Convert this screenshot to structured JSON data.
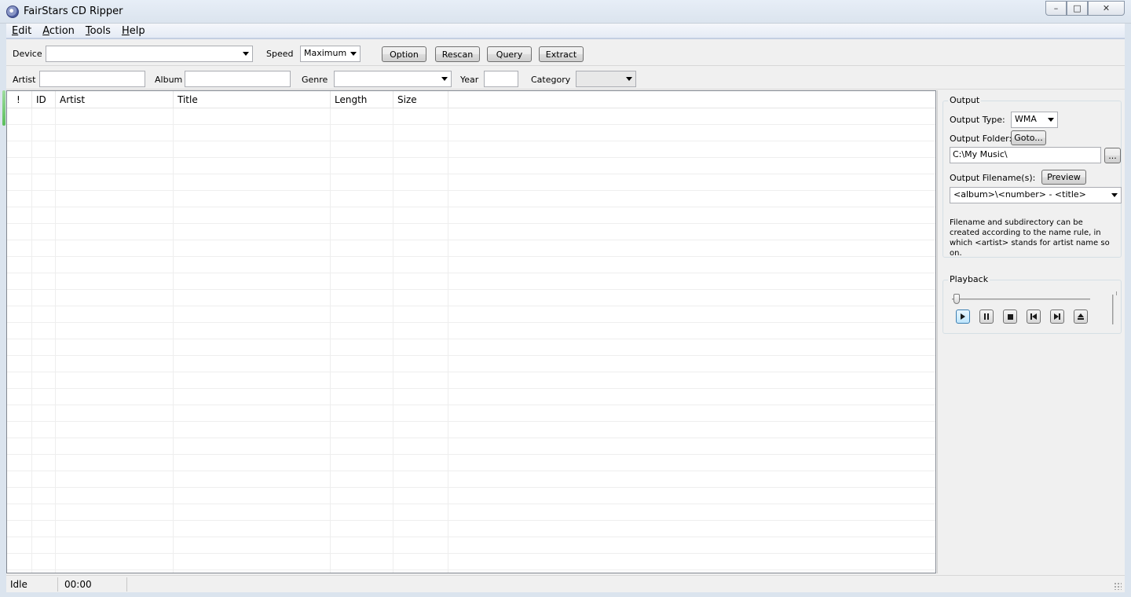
{
  "window": {
    "title": "FairStars CD Ripper",
    "min_glyph": "–",
    "max_glyph": "□",
    "close_glyph": "✕"
  },
  "menu": [
    {
      "label": "Edit",
      "accel": "E",
      "rest": "dit"
    },
    {
      "label": "Action",
      "accel": "A",
      "rest": "ction"
    },
    {
      "label": "Tools",
      "accel": "T",
      "rest": "ools"
    },
    {
      "label": "Help",
      "accel": "H",
      "rest": "elp"
    }
  ],
  "toolbar1": {
    "device_label": "Device",
    "device_value": "",
    "speed_label": "Speed",
    "speed_value": "Maximum",
    "option_btn": "Option",
    "rescan_btn": "Rescan",
    "query_btn": "Query",
    "extract_btn": "Extract"
  },
  "toolbar2": {
    "artist_label": "Artist",
    "artist_value": "",
    "album_label": "Album",
    "album_value": "",
    "genre_label": "Genre",
    "genre_value": "",
    "year_label": "Year",
    "year_value": "",
    "category_label": "Category",
    "category_value": ""
  },
  "tracklist": {
    "columns": [
      "!",
      "ID",
      "Artist",
      "Title",
      "Length",
      "Size"
    ],
    "rows": []
  },
  "output": {
    "group_title": "Output",
    "type_label": "Output Type:",
    "type_value": "WMA",
    "folder_label": "Output Folder:",
    "goto_btn": "Goto...",
    "folder_value": "C:\\My Music\\",
    "browse_btn": "...",
    "filename_label": "Output Filename(s):",
    "preview_btn": "Preview",
    "filename_value": "<album>\\<number> - <title>",
    "hint": "Filename and subdirectory can be created according to the name rule, in which <artist> stands for artist name so on."
  },
  "playback": {
    "group_title": "Playback",
    "position": 0,
    "volume": 1,
    "buttons": [
      "play-icon",
      "pause-icon",
      "stop-icon",
      "previous-icon",
      "next-icon",
      "eject-icon"
    ]
  },
  "status": {
    "state": "Idle",
    "time": "00:00"
  }
}
